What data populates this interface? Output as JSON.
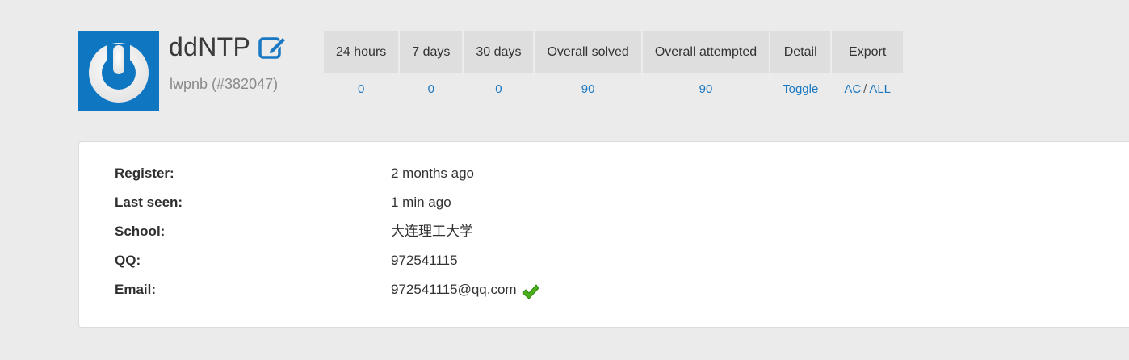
{
  "profile": {
    "display_name": "ddNTP",
    "handle": "lwpnb (#382047)",
    "avatar_icon": "power-icon",
    "edit_icon": "edit-icon"
  },
  "stats": {
    "headers": [
      "24 hours",
      "7 days",
      "30 days",
      "Overall solved",
      "Overall attempted",
      "Detail",
      "Export"
    ],
    "values": {
      "h24": "0",
      "d7": "0",
      "d30": "0",
      "solved": "90",
      "attempted": "90",
      "detail": "Toggle",
      "export_ac": "AC",
      "export_sep": "/",
      "export_all": "ALL"
    }
  },
  "info": [
    {
      "label": "Register:",
      "value": "2 months ago"
    },
    {
      "label": "Last seen:",
      "value": "1 min ago"
    },
    {
      "label": "School:",
      "value": "大连理工大学"
    },
    {
      "label": "QQ:",
      "value": "972541115"
    },
    {
      "label": "Email:",
      "value": "972541115@qq.com",
      "verified_icon": "check-icon"
    }
  ],
  "colors": {
    "accent": "#1a78c2",
    "avatar_bg": "#0f76c2",
    "verified": "#4caf1a"
  }
}
